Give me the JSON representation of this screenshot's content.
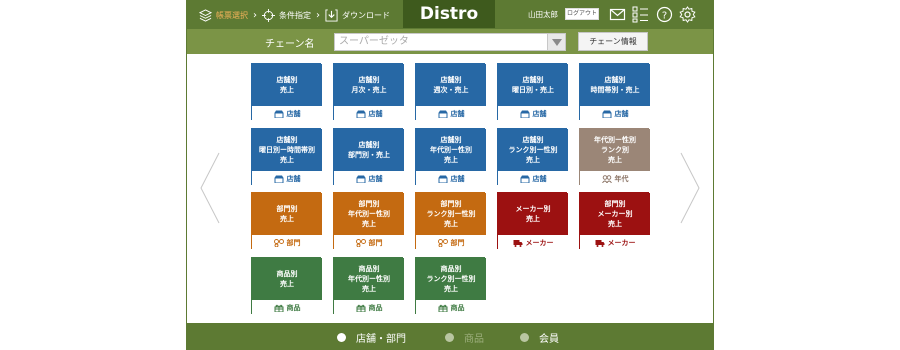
{
  "breadcrumb": {
    "items": [
      {
        "label": "帳票選択",
        "icon": "layers-icon"
      },
      {
        "label": "条件指定",
        "icon": "crosshair-icon"
      },
      {
        "label": "ダウンロード",
        "icon": "download-icon"
      }
    ]
  },
  "header": {
    "logo": "Distro",
    "user_name": "山田太郎",
    "logout_label": "ログアウト",
    "icons": [
      "mail-icon",
      "list-icon",
      "help-icon",
      "gear-icon"
    ]
  },
  "chain": {
    "label": "チェーン名",
    "selected": "スーパーゼッタ",
    "info_button": "チェーン情報"
  },
  "tiles": [
    {
      "title": [
        "店舗別",
        "売上"
      ],
      "footer": "店舗",
      "color": "blue",
      "icon": "store-icon"
    },
    {
      "title": [
        "店舗別",
        "月次・売上"
      ],
      "footer": "店舗",
      "color": "blue",
      "icon": "store-icon"
    },
    {
      "title": [
        "店舗別",
        "週次・売上"
      ],
      "footer": "店舗",
      "color": "blue",
      "icon": "store-icon"
    },
    {
      "title": [
        "店舗別",
        "曜日別・売上"
      ],
      "footer": "店舗",
      "color": "blue",
      "icon": "store-icon"
    },
    {
      "title": [
        "店舗別",
        "時間帯別・売上"
      ],
      "footer": "店舗",
      "color": "blue",
      "icon": "store-icon"
    },
    {
      "title": [
        "店舗別",
        "曜日別ー時間帯別",
        "売上"
      ],
      "footer": "店舗",
      "color": "blue",
      "icon": "store-icon"
    },
    {
      "title": [
        "店舗別",
        "部門別・売上"
      ],
      "footer": "店舗",
      "color": "blue",
      "icon": "store-icon"
    },
    {
      "title": [
        "店舗別",
        "年代別ー性別",
        "売上"
      ],
      "footer": "店舗",
      "color": "blue",
      "icon": "store-icon"
    },
    {
      "title": [
        "店舗別",
        "ランク別ー性別",
        "売上"
      ],
      "footer": "店舗",
      "color": "blue",
      "icon": "store-icon"
    },
    {
      "title": [
        "年代別ー性別",
        "ランク別",
        "売上"
      ],
      "footer": "年代",
      "color": "taupe",
      "icon": "people-icon"
    },
    {
      "title": [
        "部門別",
        "売上"
      ],
      "footer": "部門",
      "color": "orange",
      "icon": "department-icon"
    },
    {
      "title": [
        "部門別",
        "年代別ー性別",
        "売上"
      ],
      "footer": "部門",
      "color": "orange",
      "icon": "department-icon"
    },
    {
      "title": [
        "部門別",
        "ランク別ー性別",
        "売上"
      ],
      "footer": "部門",
      "color": "orange",
      "icon": "department-icon"
    },
    {
      "title": [
        "メーカー別",
        "売上"
      ],
      "footer": "メーカー",
      "color": "red",
      "icon": "truck-icon"
    },
    {
      "title": [
        "部門別",
        "メーカー別",
        "売上"
      ],
      "footer": "メーカー",
      "color": "red",
      "icon": "truck-icon"
    },
    {
      "title": [
        "商品別",
        "売上"
      ],
      "footer": "商品",
      "color": "green",
      "icon": "gift-icon"
    },
    {
      "title": [
        "商品別",
        "年代別ー性別",
        "売上"
      ],
      "footer": "商品",
      "color": "green",
      "icon": "gift-icon"
    },
    {
      "title": [
        "商品別",
        "ランク別ー性別",
        "売上"
      ],
      "footer": "商品",
      "color": "green",
      "icon": "gift-icon"
    }
  ],
  "pager": [
    {
      "label": "店舗・部門",
      "active": true
    },
    {
      "label": "商品",
      "active": false
    },
    {
      "label": "会員",
      "active": false
    }
  ],
  "colors": {
    "header": "#5d7a33",
    "subheader": "#7b9446",
    "logo_bg": "#3e5a1d",
    "blue": "#2768a5",
    "taupe": "#9b8677",
    "orange": "#c46a11",
    "red": "#9c1111",
    "green": "#3f7b43",
    "crumb_active": "#f2b35a"
  }
}
